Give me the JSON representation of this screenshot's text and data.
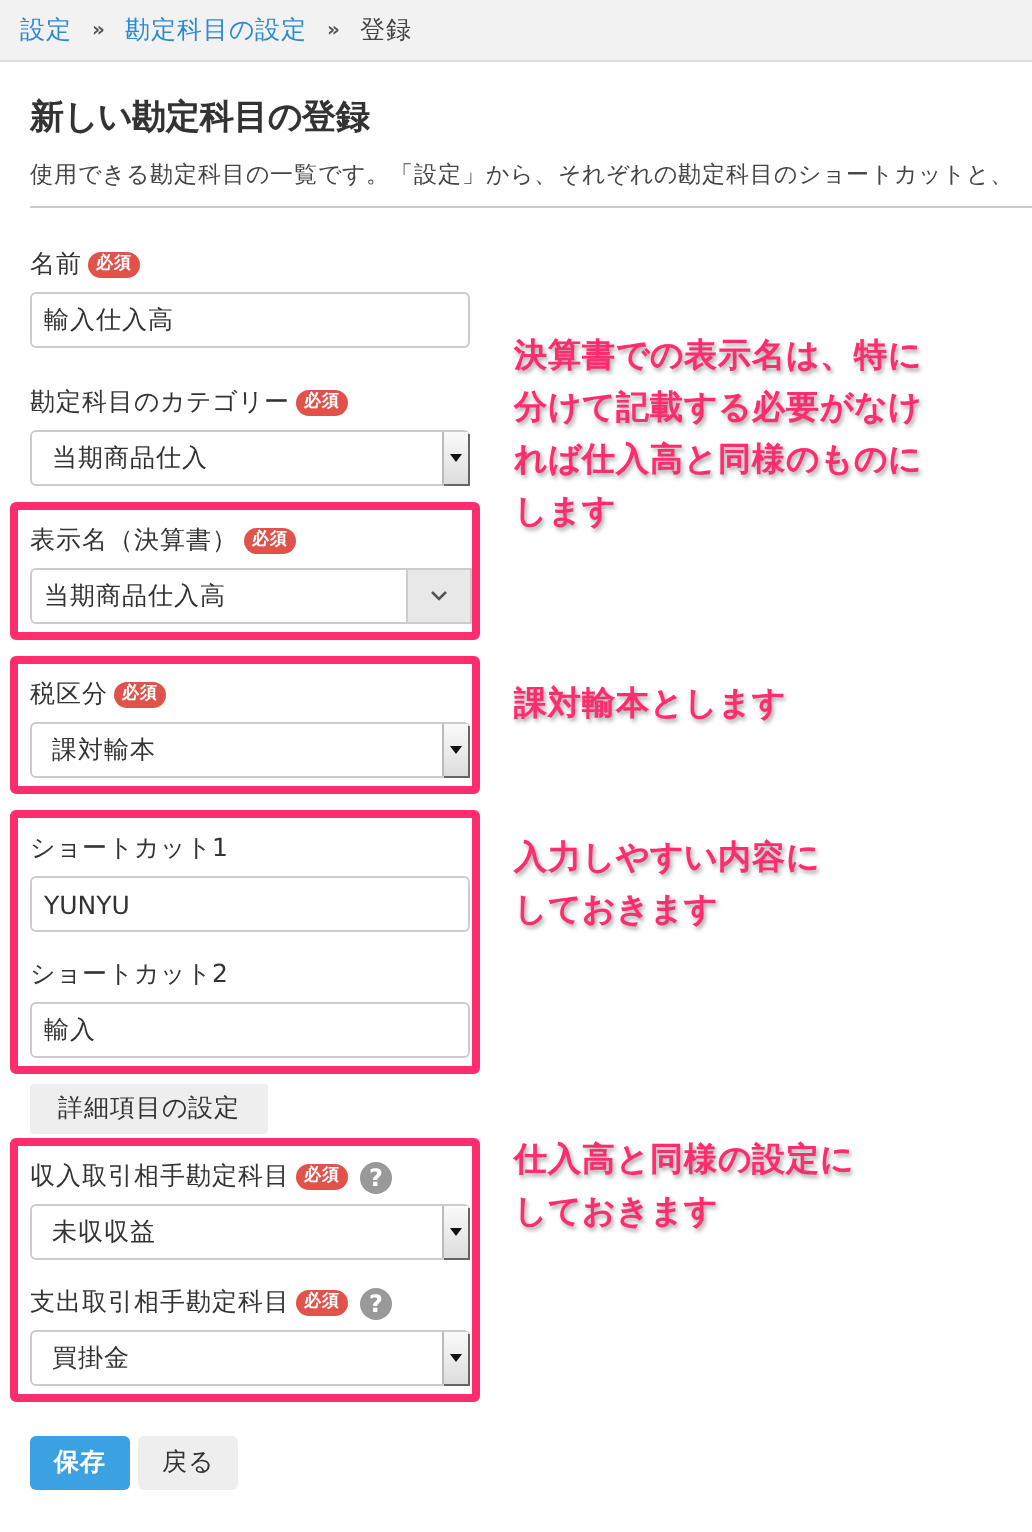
{
  "breadcrumb": [
    {
      "kind": "link",
      "label": "設定"
    },
    {
      "kind": "separator",
      "label": "»"
    },
    {
      "kind": "link",
      "label": "勘定科目の設定"
    },
    {
      "kind": "separator",
      "label": "»"
    },
    {
      "kind": "current",
      "label": "登録"
    }
  ],
  "title": "新しい勘定科目の登録",
  "description": "使用できる勘定科目の一覧です。「設定」から、それぞれの勘定科目のショートカットと、",
  "form": [
    {
      "kind": "group",
      "highlighted": false,
      "fields": [
        {
          "kind": "text",
          "label": "名前",
          "badge": "必須",
          "value": "輸入仕入高"
        }
      ]
    },
    {
      "kind": "group",
      "highlighted": false,
      "note": [
        "決算書での表示名は、特に",
        "分けて記載する必要がなけ",
        "れば仕入高と同様のものに",
        "します"
      ],
      "fields": [
        {
          "kind": "select",
          "label": "勘定科目のカテゴリー",
          "badge": "必須",
          "value": "当期商品仕入"
        }
      ]
    },
    {
      "kind": "group",
      "highlighted": true,
      "fields": [
        {
          "kind": "combo",
          "label": "表示名（決算書）",
          "badge": "必須",
          "value": "当期商品仕入高"
        }
      ]
    },
    {
      "kind": "group",
      "highlighted": true,
      "note": [
        "課対輸本とします"
      ],
      "fields": [
        {
          "kind": "select",
          "label": "税区分",
          "badge": "必須",
          "value": "課対輸本"
        }
      ]
    },
    {
      "kind": "group",
      "highlighted": true,
      "note": [
        "入力しやすい内容に",
        "しておきます"
      ],
      "fields": [
        {
          "kind": "text",
          "label": "ショートカット1",
          "value": "YUNYU"
        },
        {
          "kind": "text",
          "label": "ショートカット2",
          "value": "輸入"
        }
      ]
    },
    {
      "kind": "button",
      "label": "詳細項目の設定"
    },
    {
      "kind": "group",
      "highlighted": true,
      "note": [
        "仕入高と同様の設定に",
        "しておきます"
      ],
      "fields": [
        {
          "kind": "select",
          "label": "収入取引相手勘定科目",
          "badge": "必須",
          "help": "?",
          "value": "未収収益"
        },
        {
          "kind": "select",
          "label": "支出取引相手勘定科目",
          "badge": "必須",
          "help": "?",
          "value": "買掛金"
        }
      ]
    }
  ],
  "actions": [
    {
      "kind": "primary",
      "label": "保存"
    },
    {
      "kind": "secondary",
      "label": "戻る"
    }
  ]
}
